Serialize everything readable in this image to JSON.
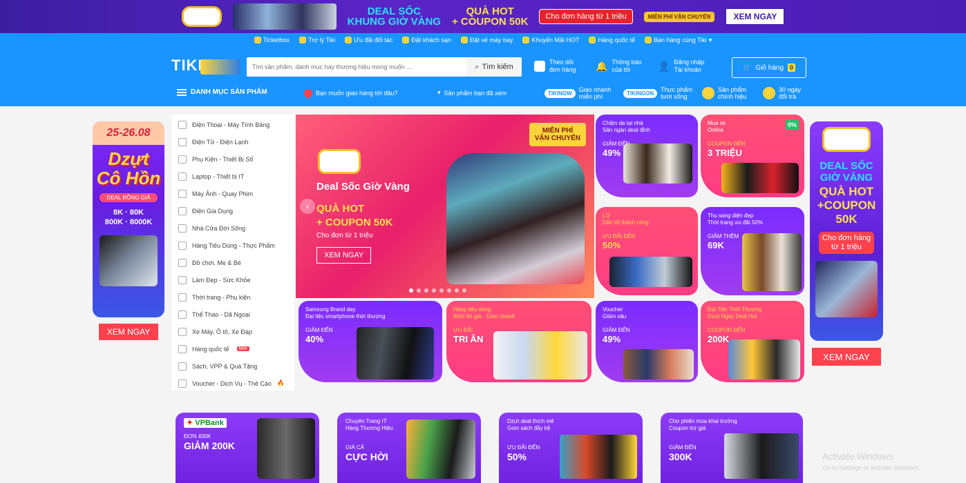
{
  "topbar": {
    "deal_line1": "DEAL SỐC",
    "deal_line2": "KHUNG GIỜ VÀNG",
    "hot_line1": "QUÀ HOT",
    "hot_line2": "+ COUPON 50K",
    "order_label": "Cho đơn hàng từ 1 triệu",
    "free_ship": "MIỄN PHÍ VẬN CHUYỂN",
    "cta": "XEM NGAY"
  },
  "strip": [
    "Ticketbox",
    "Trợ lý Tiki",
    "Ưu đãi đối tác",
    "Đặt khách sạn",
    "Đặt vé máy bay",
    "Khuyến Mãi HOT",
    "Hàng quốc tế",
    "Bán hàng cùng Tiki"
  ],
  "header": {
    "logo": "TIKI",
    "search_placeholder": "Tìm sản phẩm, danh mục hay thương hiệu mong muốn ...",
    "search_button": "Tìm kiếm",
    "orders_l1": "Theo dõi",
    "orders_l2": "đơn hàng",
    "notify_l1": "Thông báo",
    "notify_l2": "của tôi",
    "login_l1": "Đăng nhập",
    "login_l2": "Tài khoản",
    "cart_label": "Giỏ hàng",
    "cart_count": "0",
    "category": "DANH MỤC SẢN PHẨM",
    "deliver": "Bạn muốn giao hàng tới đâu?",
    "viewed": "Sản phẩm bạn đã xem",
    "tikinow": "TIKINOW",
    "tikinow_l1": "Giao nhanh",
    "tikinow_l2": "miễn phí",
    "tikingon": "TIKINGON",
    "tikingon_l1": "Thực phẩm",
    "tikingon_l2": "tươi sống",
    "genuine_l1": "Sản phẩm",
    "genuine_l2": "chính hiệu",
    "return_l1": "30 ngày",
    "return_l2": "đổi trả"
  },
  "categories": [
    "Điện Thoại - Máy Tính Bảng",
    "Điện Tử - Điện Lạnh",
    "Phụ Kiện - Thiết Bị Số",
    "Laptop - Thiết bị IT",
    "Máy Ảnh - Quay Phim",
    "Điện Gia Dụng",
    "Nhà Cửa Đời Sống",
    "Hàng Tiêu Dùng - Thực Phẩm",
    "Đồ chơi, Mẹ & Bé",
    "Làm Đẹp - Sức Khỏe",
    "Thời trang - Phụ kiện",
    "Thể Thao - Dã Ngoại",
    "Xe Máy, Ô tô, Xe Đạp",
    "Hàng quốc tế",
    "Sách, VPP & Quà Tặng",
    "Voucher - Dịch Vụ - Thẻ Cào"
  ],
  "category_badge": "Mới",
  "left_banner": {
    "date": "25-26.08",
    "title_l1": "Dzựt",
    "title_l2": "Cô Hồn",
    "same_price": "DEAL ĐỒNG GIÁ",
    "price_l1": "8K · 80K",
    "price_l2": "800K · 8000K",
    "cta": "XEM NGAY"
  },
  "hero": {
    "ship_l1": "MIỄN PHÍ",
    "ship_l2": "VẬN CHUYỂN",
    "title": "Deal Sốc Giờ Vàng",
    "hot_l1": "QUÀ HOT",
    "hot_l2": "+ COUPON 50K",
    "sub": "Cho đơn từ 1 triệu",
    "cta": "XEM NGAY",
    "slides": 8,
    "active_slide": 1
  },
  "promo_cards": [
    {
      "l1": "Chăm da tại nhà",
      "l2": "Săn ngàn deal đỉnh",
      "k": "GIẢM ĐẾN",
      "v": "49%"
    },
    {
      "l1": "Mua xe",
      "l2": "Online",
      "k": "COUPON ĐẾN",
      "v": "3 TRIỆU",
      "badge": "0%"
    },
    {
      "l1": "LG",
      "l2": "Dẫn lối thành công",
      "k": "ƯU ĐÃI ĐẾN",
      "v": "50%"
    },
    {
      "l1": "Thu sang diện đẹp",
      "l2": "Thời trang ưu đãi 50%",
      "k": "GIẢM THÊM",
      "v": "69K"
    },
    {
      "l1": "Samsung Brand day",
      "l2": "Đại tiệc smartphone thời thượng",
      "k": "GIẢM ĐẾN",
      "v": "40%"
    },
    {
      "l1": "Hàng tiêu dùng",
      "l2": "Bình ổn giá - Giao nhanh",
      "k": "ƯU ĐÃI",
      "v": "TRI ÂN"
    },
    {
      "l1": "Voucher",
      "l2": "Giảm sâu",
      "k": "GIẢM ĐẾN",
      "v": "49%"
    },
    {
      "l1": "Đại Tiệc Thời Thượng",
      "l2": "Dzựt Ngay Deal Hot",
      "k": "COUPON ĐẾN",
      "v": "200K"
    }
  ],
  "right_banner": {
    "deal_l1": "DEAL SỐC",
    "deal_l2": "GIỜ VÀNG",
    "hot_l1": "QUÀ HOT",
    "hot_l2": "+COUPON",
    "hot_l3": "50K",
    "order_l1": "Cho đơn hàng",
    "order_l2": "từ 1 triệu",
    "cta": "XEM NGAY"
  },
  "bottom_cards": [
    {
      "brand": "VPBank",
      "k": "ĐƠN 400K",
      "v": "GIẢM 200K"
    },
    {
      "l1": "Chuyên Trang IT",
      "l2": "Hàng Thương Hiệu",
      "k": "GIÁ CẢ",
      "v": "CỰC HỜI"
    },
    {
      "l1": "Dzựt deal thích mê",
      "l2": "Gom sách đầy kệ",
      "k": "ƯU ĐÃI ĐẾN",
      "v": "50%"
    },
    {
      "l1": "Chợ phiên mùa khai trường",
      "l2": "Coupon trợ giá",
      "k": "GIẢM ĐẾN",
      "v": "300K"
    }
  ],
  "watermark": {
    "l1": "Activate Windows",
    "l2": "Go to Settings to activate Windows."
  },
  "colors": {
    "tiki_blue": "#1a94ff",
    "accent_red": "#ff424e",
    "promo_purple": "#5a24c6"
  }
}
